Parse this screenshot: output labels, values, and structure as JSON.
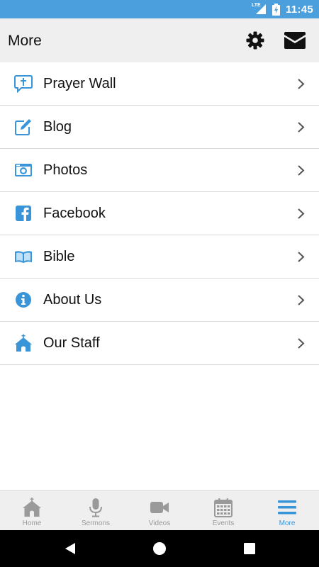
{
  "status_bar": {
    "network": "LTE",
    "time": "11:45"
  },
  "header": {
    "title": "More",
    "settings_icon": "gear-icon",
    "mail_icon": "envelope-icon"
  },
  "menu_items": [
    {
      "label": "Prayer Wall",
      "icon": "prayer-wall-icon"
    },
    {
      "label": "Blog",
      "icon": "edit-icon"
    },
    {
      "label": "Photos",
      "icon": "camera-icon"
    },
    {
      "label": "Facebook",
      "icon": "facebook-icon"
    },
    {
      "label": "Bible",
      "icon": "book-icon"
    },
    {
      "label": "About Us",
      "icon": "info-icon"
    },
    {
      "label": "Our Staff",
      "icon": "church-icon"
    }
  ],
  "tab_bar": [
    {
      "label": "Home",
      "icon": "church-icon",
      "active": false
    },
    {
      "label": "Sermons",
      "icon": "microphone-icon",
      "active": false
    },
    {
      "label": "Videos",
      "icon": "video-camera-icon",
      "active": false
    },
    {
      "label": "Events",
      "icon": "calendar-icon",
      "active": false
    },
    {
      "label": "More",
      "icon": "hamburger-icon",
      "active": true
    }
  ],
  "colors": {
    "accent": "#3a95d8",
    "status_bar": "#4a9fdc",
    "header_bg": "#efefef",
    "inactive_tab": "#9a9a9a"
  }
}
